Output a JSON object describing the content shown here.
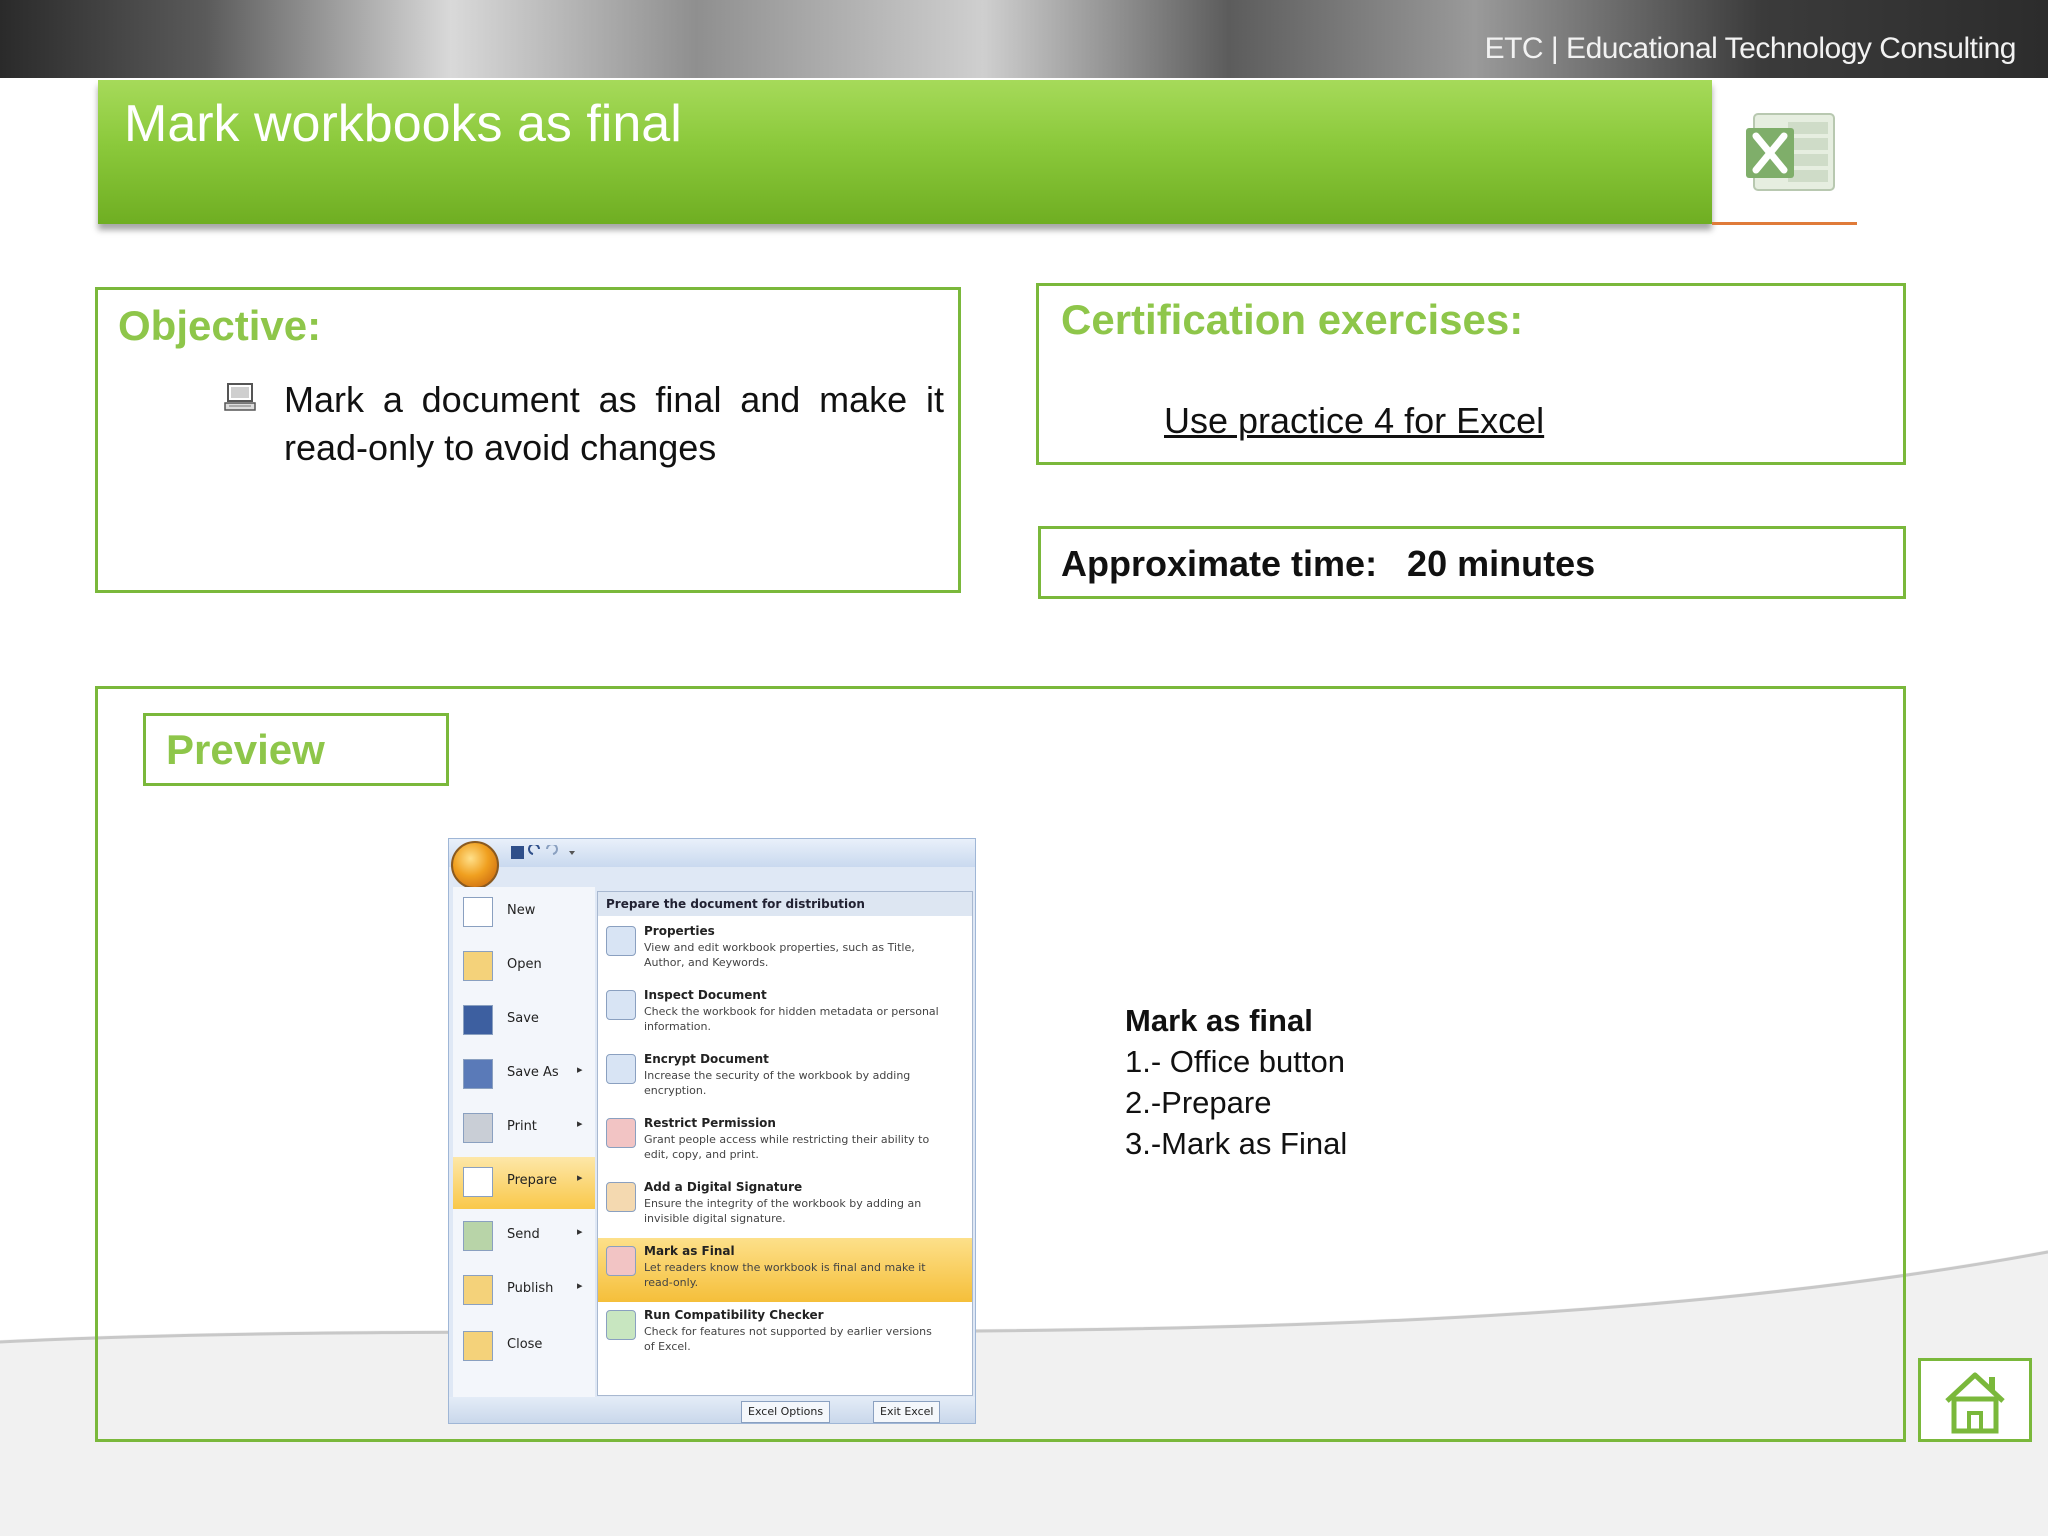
{
  "header": {
    "org_text": "ETC | Educational Technology Consulting"
  },
  "title": "Mark workbooks as final",
  "objective": {
    "heading": "Objective:",
    "text": "Mark a document as final and make it read-only to avoid changes",
    "bullet_icon": "computer-icon"
  },
  "certification": {
    "heading": "Certification exercises:",
    "link_text": "Use practice 4 for Excel"
  },
  "time": {
    "label": "Approximate time:   20 minutes"
  },
  "preview": {
    "heading": "Preview",
    "steps_title": "Mark as final",
    "steps": [
      "1.- Office button",
      "2.-Prepare",
      "3.-Mark as Final"
    ]
  },
  "screenshot": {
    "left_menu": [
      {
        "label": "New",
        "arrow": ""
      },
      {
        "label": "Open",
        "arrow": ""
      },
      {
        "label": "Save",
        "arrow": ""
      },
      {
        "label": "Save As",
        "arrow": "▸"
      },
      {
        "label": "Print",
        "arrow": "▸"
      },
      {
        "label": "Prepare",
        "arrow": "▸"
      },
      {
        "label": "Send",
        "arrow": "▸"
      },
      {
        "label": "Publish",
        "arrow": "▸"
      },
      {
        "label": "Close",
        "arrow": ""
      }
    ],
    "submenu_header": "Prepare the document for distribution",
    "submenu": [
      {
        "title": "Properties",
        "desc": "View and edit workbook properties, such as Title, Author, and Keywords."
      },
      {
        "title": "Inspect Document",
        "desc": "Check the workbook for hidden metadata or personal information."
      },
      {
        "title": "Encrypt Document",
        "desc": "Increase the security of the workbook by adding encryption."
      },
      {
        "title": "Restrict Permission",
        "desc": "Grant people access while restricting their ability to edit, copy, and print."
      },
      {
        "title": "Add a Digital Signature",
        "desc": "Ensure the integrity of the workbook by adding an invisible digital signature."
      },
      {
        "title": "Mark as Final",
        "desc": "Let readers know the workbook is final and make it read-only."
      },
      {
        "title": "Run Compatibility Checker",
        "desc": "Check for features not supported by earlier versions of Excel."
      }
    ],
    "excel_options": "Excel Options",
    "exit_excel": "Exit Excel"
  },
  "colors": {
    "accent_green": "#8ec64a",
    "border_green": "#7ab83b",
    "orange_line": "#e07b39"
  }
}
